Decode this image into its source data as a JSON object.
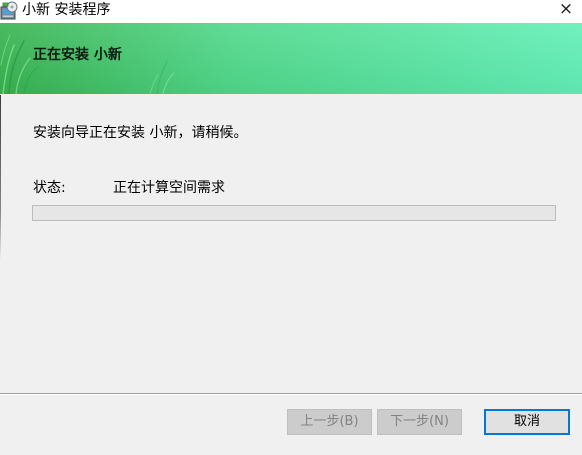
{
  "window": {
    "title": "小新 安装程序",
    "icon": "installer-icon",
    "close_button": {
      "glyph": "×",
      "icon": "close-icon"
    }
  },
  "banner": {
    "title": "正在安装 小新",
    "gradient_colors": [
      "#37b24f",
      "#4fd88a",
      "#61efb7"
    ]
  },
  "content": {
    "message": "安装向导正在安装 小新，请稍候。",
    "status": {
      "label": "状态:",
      "value": "正在计算空间需求"
    },
    "progress": {
      "fraction": 0
    }
  },
  "footer": {
    "buttons": {
      "back": {
        "label": "上一步(B)",
        "enabled": false
      },
      "next": {
        "label": "下一步(N)",
        "enabled": false
      },
      "cancel": {
        "label": "取消",
        "enabled": true,
        "is_default": true
      }
    }
  },
  "theme": {
    "dialog_background": "#f0f0f0",
    "focus_border": "#0078d7"
  }
}
